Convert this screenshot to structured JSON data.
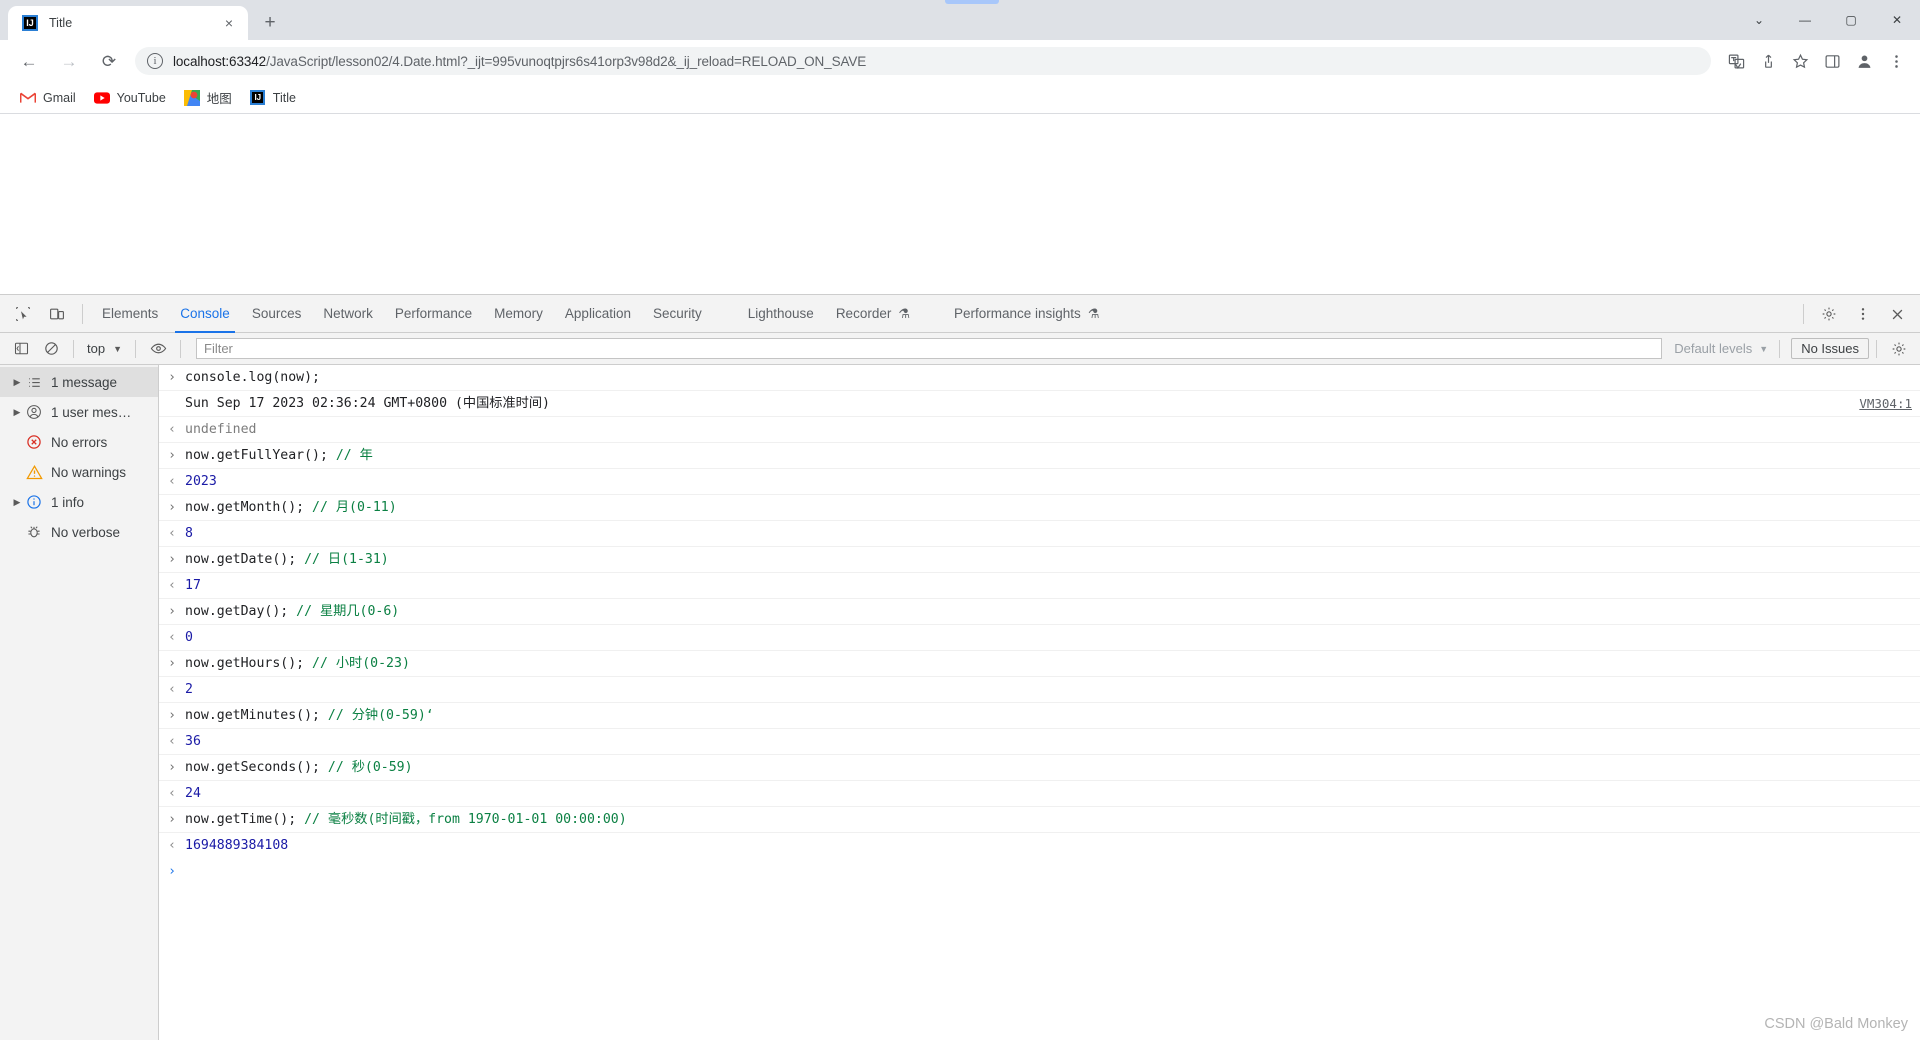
{
  "browser": {
    "tab": {
      "title": "Title",
      "favicon": "IJ",
      "close_label": "×"
    },
    "new_tab_label": "+",
    "window_controls": {
      "menu": "⌄",
      "minimize": "—",
      "maximize": "▢",
      "close": "✕"
    },
    "nav": {
      "back": "←",
      "forward": "→",
      "reload": "⟳"
    },
    "omnibox": {
      "info_icon": "i",
      "url": "localhost:63342/JavaScript/lesson02/4.Date.html?_ijt=995vunoqtpjrs6s41orp3v98d2&_ij_reload=RELOAD_ON_SAVE",
      "url_host": "localhost:63342",
      "url_path": "/JavaScript/lesson02/4.Date.html?_ijt=995vunoqtpjrs6s41orp3v98d2&_ij_reload=RELOAD_ON_SAVE"
    },
    "toolbar_icons": [
      "translate-icon",
      "share-icon",
      "star-icon",
      "sidepanel-icon",
      "profile-icon",
      "more-icon"
    ],
    "bookmarks": [
      {
        "label": "Gmail",
        "icon": "M"
      },
      {
        "label": "YouTube",
        "icon": "▶"
      },
      {
        "label": "地图",
        "icon": "📍"
      },
      {
        "label": "Title",
        "icon": "IJ"
      }
    ]
  },
  "devtools": {
    "inspect_icon": "cursor-inspect-icon",
    "device_icon": "device-toolbar-icon",
    "tabs": [
      {
        "label": "Elements",
        "active": false,
        "flask": false
      },
      {
        "label": "Console",
        "active": true,
        "flask": false
      },
      {
        "label": "Sources",
        "active": false,
        "flask": false
      },
      {
        "label": "Network",
        "active": false,
        "flask": false
      },
      {
        "label": "Performance",
        "active": false,
        "flask": false
      },
      {
        "label": "Memory",
        "active": false,
        "flask": false
      },
      {
        "label": "Application",
        "active": false,
        "flask": false
      },
      {
        "label": "Security",
        "active": false,
        "flask": false
      },
      {
        "label": "Lighthouse",
        "active": false,
        "flask": false
      },
      {
        "label": "Recorder",
        "active": false,
        "flask": true
      },
      {
        "label": "Performance insights",
        "active": false,
        "flask": true
      }
    ],
    "flask_glyph": "⚗",
    "right_actions": {
      "settings": "gear-icon",
      "more": "⋮",
      "close": "✕"
    },
    "console_toolbar": {
      "sidebar_toggle": "sidebar-toggle-icon",
      "clear": "clear-console-icon",
      "context": "top",
      "context_caret": "▼",
      "eye": "live-expression-icon",
      "filter_placeholder": "Filter",
      "filter_value": "",
      "levels_label": "Default levels",
      "levels_caret": "▼",
      "issues_label": "No Issues",
      "settings": "gear-icon"
    },
    "sidebar": [
      {
        "label": "1 message",
        "icon": "list-icon",
        "arrow": "▶",
        "selected": true
      },
      {
        "label": "1 user mes…",
        "icon": "user-icon",
        "arrow": "▶",
        "selected": false
      },
      {
        "label": "No errors",
        "icon": "error-icon",
        "arrow": "",
        "selected": false
      },
      {
        "label": "No warnings",
        "icon": "warning-icon",
        "arrow": "",
        "selected": false
      },
      {
        "label": "1 info",
        "icon": "info-icon",
        "arrow": "▶",
        "selected": false
      },
      {
        "label": "No verbose",
        "icon": "verbose-icon",
        "arrow": "",
        "selected": false
      }
    ],
    "console_rows": [
      {
        "gutter": "›",
        "kind": "input",
        "code": "console.log(now);",
        "comment": ""
      },
      {
        "gutter": "",
        "kind": "output-log",
        "code": "Sun Sep 17 2023 02:36:24 GMT+0800 (中国标准时间)",
        "comment": "",
        "source": "VM304:1"
      },
      {
        "gutter": "‹",
        "kind": "result-undefined",
        "code": "undefined",
        "comment": ""
      },
      {
        "gutter": "›",
        "kind": "input",
        "code": "now.getFullYear(); ",
        "comment": "// 年"
      },
      {
        "gutter": "‹",
        "kind": "result-number",
        "code": "2023",
        "comment": ""
      },
      {
        "gutter": "›",
        "kind": "input",
        "code": "now.getMonth(); ",
        "comment": "// 月(0-11)"
      },
      {
        "gutter": "‹",
        "kind": "result-number",
        "code": "8",
        "comment": ""
      },
      {
        "gutter": "›",
        "kind": "input",
        "code": "now.getDate(); ",
        "comment": "// 日(1-31)"
      },
      {
        "gutter": "‹",
        "kind": "result-number",
        "code": "17",
        "comment": ""
      },
      {
        "gutter": "›",
        "kind": "input",
        "code": "now.getDay(); ",
        "comment": "// 星期几(0-6)"
      },
      {
        "gutter": "‹",
        "kind": "result-number",
        "code": "0",
        "comment": ""
      },
      {
        "gutter": "›",
        "kind": "input",
        "code": "now.getHours(); ",
        "comment": "// 小时(0-23)"
      },
      {
        "gutter": "‹",
        "kind": "result-number",
        "code": "2",
        "comment": ""
      },
      {
        "gutter": "›",
        "kind": "input",
        "code": "now.getMinutes(); ",
        "comment": "// 分钟(0-59)‘"
      },
      {
        "gutter": "‹",
        "kind": "result-number",
        "code": "36",
        "comment": ""
      },
      {
        "gutter": "›",
        "kind": "input",
        "code": "now.getSeconds(); ",
        "comment": "// 秒(0-59)"
      },
      {
        "gutter": "‹",
        "kind": "result-number",
        "code": "24",
        "comment": ""
      },
      {
        "gutter": "›",
        "kind": "input",
        "code": "now.getTime(); ",
        "comment": "// 毫秒数(时间戳，from 1970-01-01 00:00:00)"
      },
      {
        "gutter": "‹",
        "kind": "result-number",
        "code": "1694889384108",
        "comment": ""
      }
    ],
    "prompt_caret": "›"
  },
  "watermark": "CSDN @Bald Monkey",
  "colors": {
    "accent": "#1a73e8",
    "comment_green": "#0b8043",
    "number_blue": "#1a1aa6",
    "tabstrip_bg": "#dee1e6",
    "devtools_bg": "#f3f3f3",
    "error_red": "#d93025",
    "warning_orange": "#f29900"
  }
}
